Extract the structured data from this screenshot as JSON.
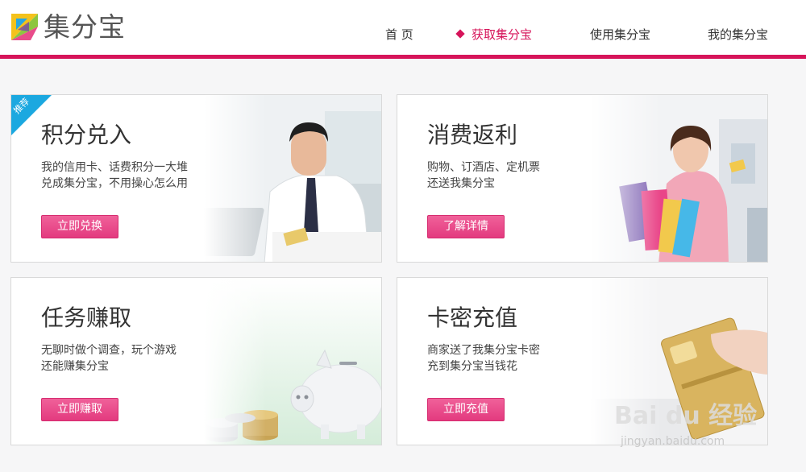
{
  "header": {
    "logo_text": "集分宝",
    "nav": [
      {
        "label": "首 页",
        "active": false
      },
      {
        "label": "获取集分宝",
        "active": true
      },
      {
        "label": "使用集分宝",
        "active": false
      },
      {
        "label": "我的集分宝",
        "active": false
      }
    ]
  },
  "colors": {
    "accent": "#d6145a",
    "button": "#e94588",
    "ribbon": "#1ba8e0"
  },
  "cards": [
    {
      "badge": "推荐",
      "title": "积分兑入",
      "desc": [
        "我的信用卡、话费积分一大堆",
        "兑成集分宝，不用操心怎么用"
      ],
      "button": "立即兑换",
      "image": "businessman-with-card-illustration"
    },
    {
      "title": "消费返利",
      "desc": [
        "购物、订酒店、定机票",
        "还送我集分宝"
      ],
      "button": "了解详情",
      "image": "woman-with-shopping-bags-illustration"
    },
    {
      "title": "任务赚取",
      "desc": [
        "无聊时做个调查，玩个游戏",
        "还能赚集分宝"
      ],
      "button": "立即赚取",
      "image": "piggy-bank-and-coins-illustration"
    },
    {
      "title": "卡密充值",
      "desc": [
        "商家送了我集分宝卡密",
        "充到集分宝当钱花"
      ],
      "button": "立即充值",
      "image": "hand-holding-card-illustration"
    }
  ],
  "watermark": {
    "text": "Bai du 经验",
    "sub": "jingyan.baidu.com"
  }
}
